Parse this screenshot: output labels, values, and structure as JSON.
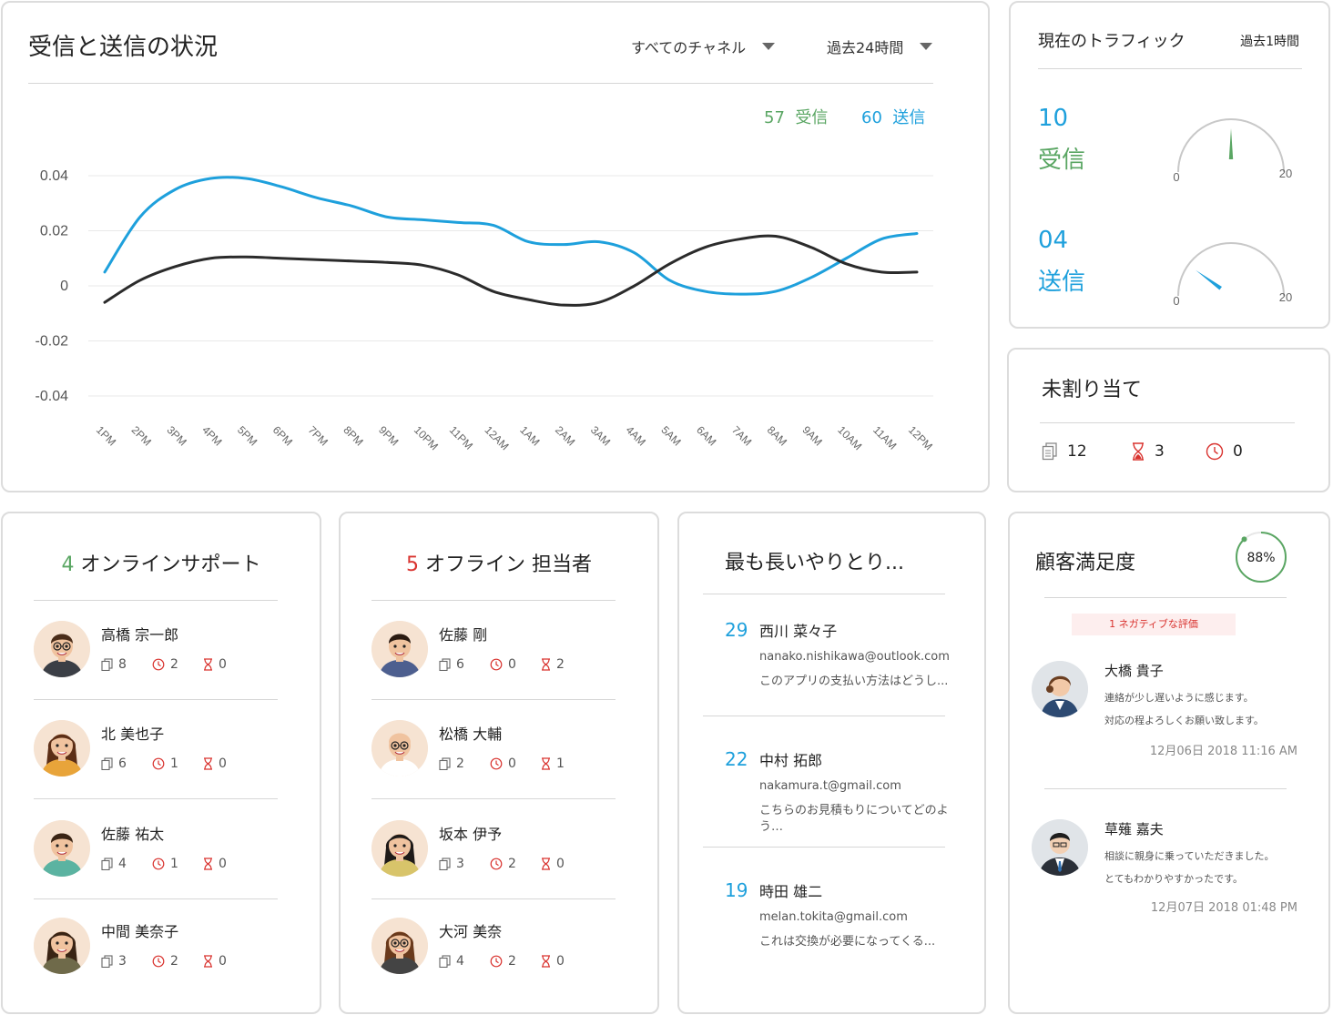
{
  "traffic_chart": {
    "title": "受信と送信の状況",
    "channel_filter": "すべてのチャネル",
    "time_filter": "過去24時間",
    "legend": {
      "incoming_count": "57",
      "incoming_label": "受信",
      "outgoing_count": "60",
      "outgoing_label": "送信"
    }
  },
  "chart_data": {
    "type": "line",
    "categories": [
      "1PM",
      "2PM",
      "3PM",
      "4PM",
      "5PM",
      "6PM",
      "7PM",
      "8PM",
      "9PM",
      "10PM",
      "11PM",
      "12AM",
      "1AM",
      "2AM",
      "3AM",
      "4AM",
      "5AM",
      "6AM",
      "7AM",
      "8AM",
      "9AM",
      "10AM",
      "11AM",
      "12PM"
    ],
    "y_ticks": [
      "0.04",
      "0.02",
      "0",
      "-0.02",
      "-0.04"
    ],
    "ylim": [
      -0.04,
      0.04
    ],
    "grid": true,
    "series": [
      {
        "name": "送信",
        "color": "#1ea0dc",
        "values": [
          0.005,
          0.025,
          0.035,
          0.039,
          0.039,
          0.036,
          0.032,
          0.029,
          0.025,
          0.024,
          0.023,
          0.022,
          0.016,
          0.015,
          0.016,
          0.012,
          0.002,
          -0.002,
          -0.003,
          -0.002,
          0.003,
          0.01,
          0.017,
          0.019
        ]
      },
      {
        "name": "受信",
        "color": "#2b2b2b",
        "values": [
          -0.006,
          0.002,
          0.007,
          0.01,
          0.0105,
          0.01,
          0.0095,
          0.009,
          0.0085,
          0.0075,
          0.004,
          -0.002,
          -0.005,
          -0.007,
          -0.006,
          0.0,
          0.008,
          0.014,
          0.017,
          0.018,
          0.014,
          0.008,
          0.005,
          0.005
        ]
      }
    ]
  },
  "current_traffic": {
    "title": "現在のトラフィック",
    "range": "過去1時間",
    "incoming_value": "10",
    "incoming_label": "受信",
    "outgoing_value": "04",
    "outgoing_label": "送信",
    "gauge_min": "0",
    "gauge_max": "20",
    "incoming_level": 10,
    "outgoing_level": 4,
    "incoming_needle_color": "#5aa663",
    "outgoing_needle_color": "#1ea0dc"
  },
  "unassigned": {
    "title": "未割り当て",
    "docs": "12",
    "waiting": "3",
    "clock": "0"
  },
  "online": {
    "count": "4",
    "title": "オンラインサポート",
    "agents": [
      {
        "name": "高橋 宗一郎",
        "docs": "8",
        "clock": "2",
        "wait": "0"
      },
      {
        "name": "北 美也子",
        "docs": "6",
        "clock": "1",
        "wait": "0"
      },
      {
        "name": "佐藤 祐太",
        "docs": "4",
        "clock": "1",
        "wait": "0"
      },
      {
        "name": "中間 美奈子",
        "docs": "3",
        "clock": "2",
        "wait": "0"
      }
    ]
  },
  "offline": {
    "count": "5",
    "title": "オフライン 担当者",
    "agents": [
      {
        "name": "佐藤 剛",
        "docs": "6",
        "clock": "0",
        "wait": "2"
      },
      {
        "name": "松橋 大輔",
        "docs": "2",
        "clock": "0",
        "wait": "1"
      },
      {
        "name": "坂本 伊予",
        "docs": "3",
        "clock": "2",
        "wait": "0"
      },
      {
        "name": "大河 美奈",
        "docs": "4",
        "clock": "2",
        "wait": "0"
      }
    ]
  },
  "longest": {
    "title": "最も長いやりとり...",
    "items": [
      {
        "count": "29",
        "name": "西川 菜々子",
        "email": "nanako.nishikawa@outlook.com",
        "message": "このアプリの支払い方法はどうし..."
      },
      {
        "count": "22",
        "name": "中村 拓郎",
        "email": "nakamura.t@gmail.com",
        "message": "こちらのお見積もりについてどのよう…"
      },
      {
        "count": "19",
        "name": "時田 雄二",
        "email": "melan.tokita@gmail.com",
        "message": "これは交換が必要になってくる..."
      }
    ]
  },
  "satisfaction": {
    "title": "顧客満足度",
    "percent_label": "88%",
    "percent": 88,
    "negative_badge": "1 ネガティブな評価",
    "reviews": [
      {
        "name": "大橋 貴子",
        "line1": "連絡が少し遅いように感じます。",
        "line2": "対応の程よろしくお願い致します。",
        "date": "12月06日 2018 11:16 AM"
      },
      {
        "name": "草薙 嘉夫",
        "line1": "相談に親身に乗っていただきました。",
        "line2": "とてもわかりやすかったです。",
        "date": "12月07日 2018 01:48 PM"
      }
    ]
  }
}
